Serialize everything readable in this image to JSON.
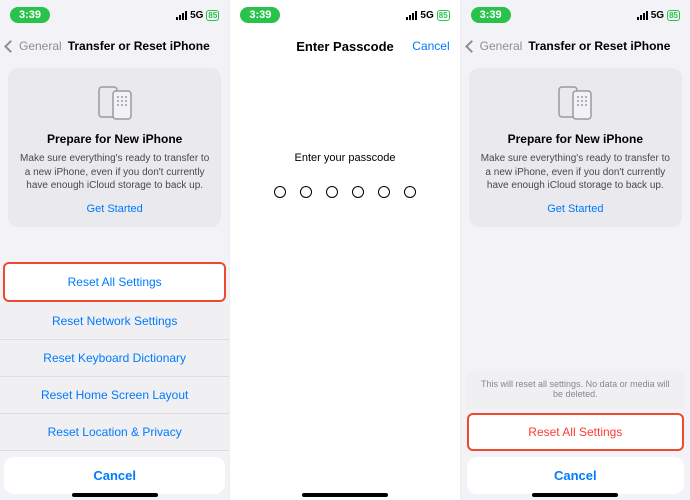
{
  "status": {
    "time": "3:39",
    "network": "5G",
    "battery": "85"
  },
  "screen1": {
    "back_label": "General",
    "title": "Transfer or Reset iPhone",
    "card": {
      "heading": "Prepare for New iPhone",
      "body": "Make sure everything's ready to transfer to a new iPhone, even if you don't currently have enough iCloud storage to back up.",
      "cta": "Get Started"
    },
    "sheet": {
      "options": [
        "Reset All Settings",
        "Reset Network Settings",
        "Reset Keyboard Dictionary",
        "Reset Home Screen Layout",
        "Reset Location & Privacy"
      ],
      "cancel": "Cancel"
    }
  },
  "screen2": {
    "title": "Enter Passcode",
    "cancel": "Cancel",
    "prompt": "Enter your passcode"
  },
  "screen3": {
    "back_label": "General",
    "title": "Transfer or Reset iPhone",
    "card": {
      "heading": "Prepare for New iPhone",
      "body": "Make sure everything's ready to transfer to a new iPhone, even if you don't currently have enough iCloud storage to back up.",
      "cta": "Get Started"
    },
    "confirm": {
      "message": "This will reset all settings. No data or media will be deleted.",
      "action": "Reset All Settings",
      "cancel": "Cancel"
    }
  }
}
